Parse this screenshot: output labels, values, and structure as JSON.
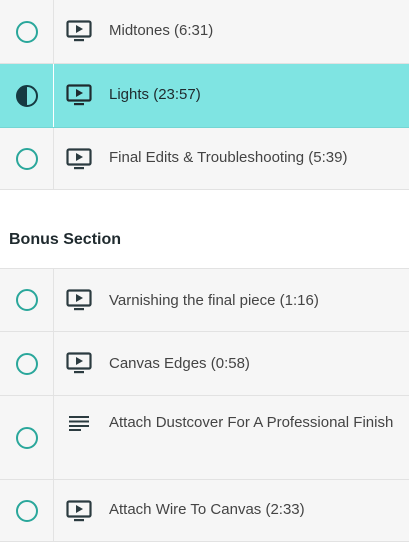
{
  "lessons_top": [
    {
      "title": "Midtones (6:31)",
      "status": "not-started",
      "icon": "video-play-icon"
    },
    {
      "title": "Lights (23:57)",
      "status": "in-progress",
      "icon": "video-play-icon"
    },
    {
      "title": "Final Edits & Troubleshooting (5:39)",
      "status": "not-started",
      "icon": "video-play-icon"
    }
  ],
  "bonus_section": {
    "heading": "Bonus Section",
    "lessons": [
      {
        "title": "Varnishing the final piece (1:16)",
        "status": "not-started",
        "icon": "video-play-icon"
      },
      {
        "title": "Canvas Edges (0:58)",
        "status": "not-started",
        "icon": "video-play-icon"
      },
      {
        "title": "Attach Dustcover For A Professional Finish",
        "status": "not-started",
        "icon": "text-lines-icon"
      },
      {
        "title": "Attach Wire To Canvas (2:33)",
        "status": "not-started",
        "icon": "video-play-icon"
      }
    ]
  },
  "colors": {
    "active_row": "#7fe4e2",
    "status_circle": "#2aa79b",
    "in_progress_fill": "#163a42"
  }
}
